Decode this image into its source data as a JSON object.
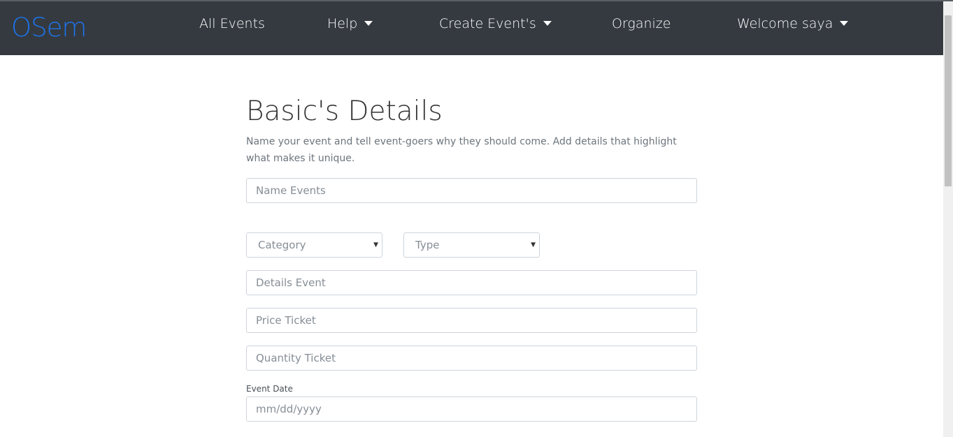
{
  "navbar": {
    "brand": "OSem",
    "items": [
      {
        "label": "All Events",
        "dropdown": false
      },
      {
        "label": "Help",
        "dropdown": true
      },
      {
        "label": "Create Event's",
        "dropdown": true
      },
      {
        "label": "Organize",
        "dropdown": false
      },
      {
        "label": "Welcome saya",
        "dropdown": true
      }
    ]
  },
  "form": {
    "title": "Basic's Details",
    "description": "Name your event and tell event-goers why they should come. Add details that highlight what makes it unique.",
    "name_placeholder": "Name Events",
    "category_value": "Category",
    "type_value": "Type",
    "details_placeholder": "Details Event",
    "price_placeholder": "Price Ticket",
    "quantity_placeholder": "Quantity Ticket",
    "date_label": "Event Date",
    "date_placeholder": "mm/dd/yyyy"
  },
  "colors": {
    "navbar_bg": "#343a40",
    "brand": "#1e73e8"
  }
}
